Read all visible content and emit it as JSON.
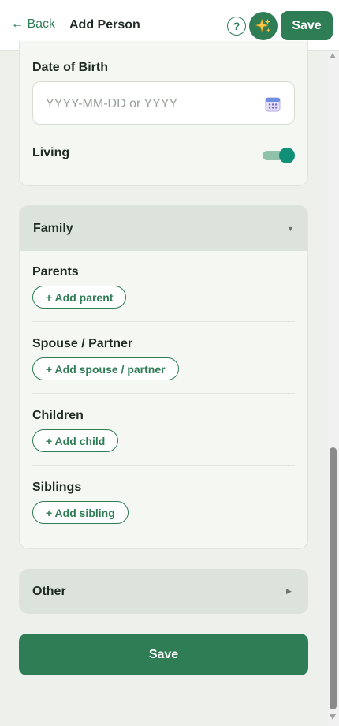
{
  "header": {
    "back_label": "← Back",
    "title": "Add Person",
    "help_label": "?",
    "magic_icon": "sparkles-icon",
    "save_label": "Save"
  },
  "basic": {
    "dob_label": "Date of Birth",
    "dob_placeholder": "YYYY-MM-DD or YYYY",
    "living_label": "Living",
    "living_on": true
  },
  "family": {
    "title": "Family",
    "parents_label": "Parents",
    "add_parent": "+ Add parent",
    "spouse_label": "Spouse / Partner",
    "add_spouse": "+ Add spouse / partner",
    "children_label": "Children",
    "add_child": "+ Add child",
    "siblings_label": "Siblings",
    "add_sibling": "+ Add sibling"
  },
  "other": {
    "title": "Other"
  },
  "footer": {
    "save_label": "Save"
  },
  "colors": {
    "accent": "#2e7d55",
    "toggle_on": "#0f8f78",
    "background": "#eef1eb",
    "section_header": "#dbe3dc"
  }
}
